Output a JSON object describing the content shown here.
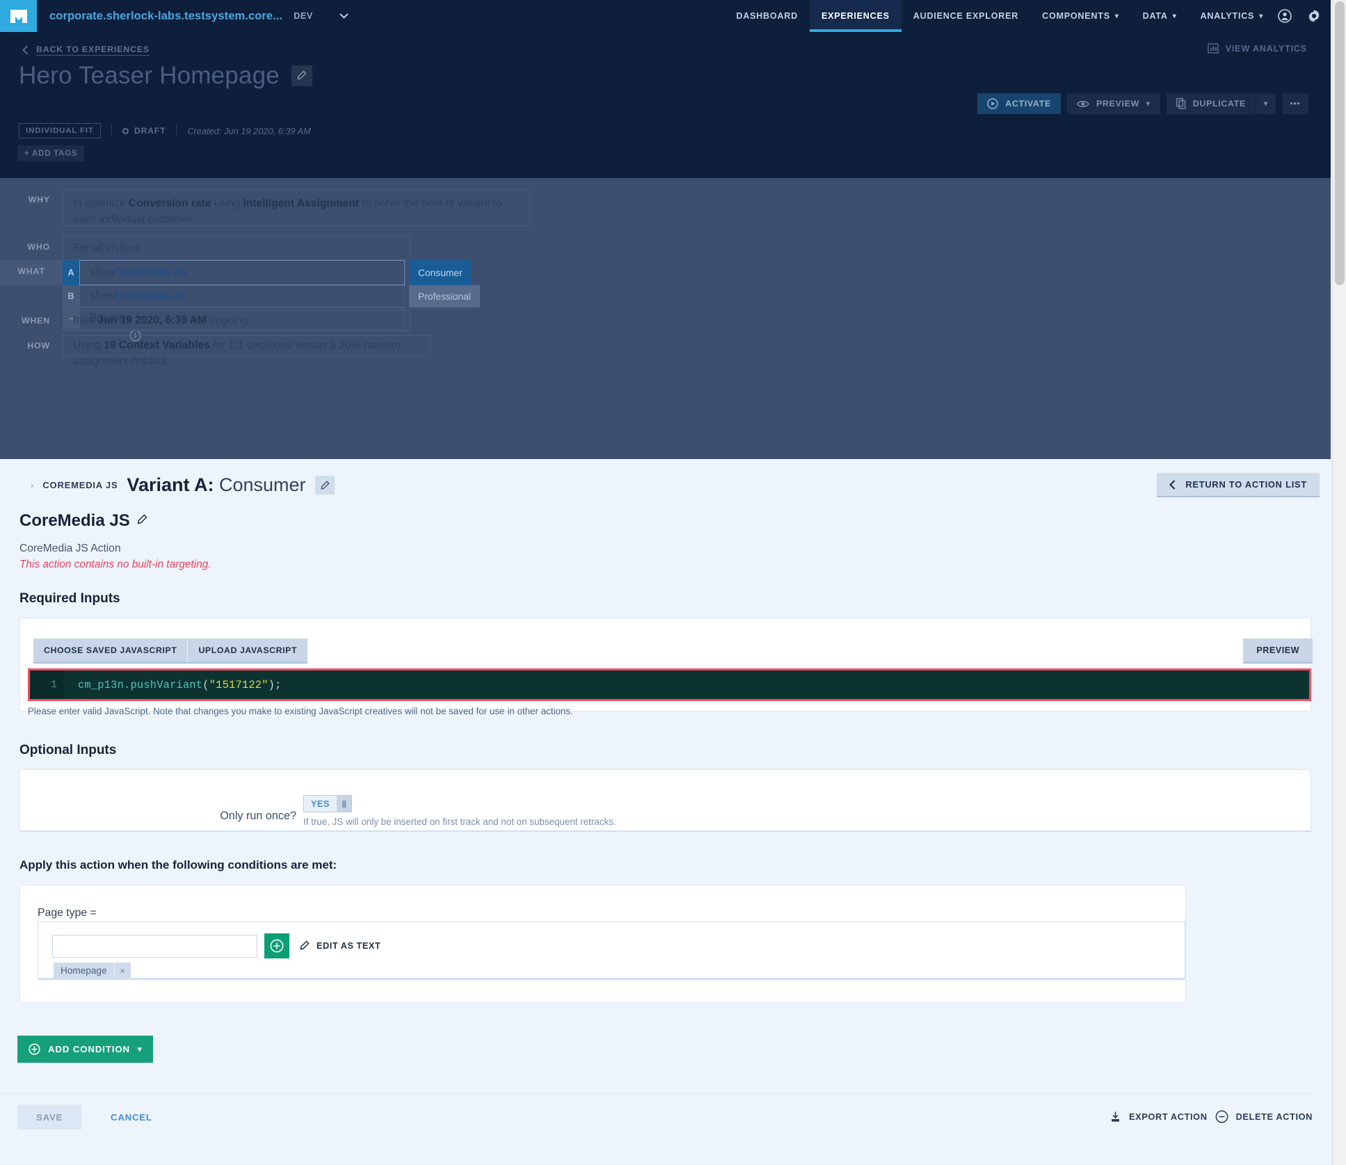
{
  "topnav": {
    "logo_icon": "mailbox-logo-icon",
    "site_name": "corporate.sherlock-labs.testsystem.core...",
    "env": "DEV",
    "env_caret_icon": "chevron-down-icon",
    "items": [
      {
        "label": "DASHBOARD",
        "caret": false,
        "active": false
      },
      {
        "label": "EXPERIENCES",
        "caret": false,
        "active": true
      },
      {
        "label": "AUDIENCE EXPLORER",
        "caret": false,
        "active": false
      },
      {
        "label": "COMPONENTS",
        "caret": true,
        "active": false
      },
      {
        "label": "DATA",
        "caret": true,
        "active": false
      },
      {
        "label": "ANALYTICS",
        "caret": true,
        "active": false
      }
    ],
    "account_icon": "user-circle-icon",
    "settings_icon": "gear-icon"
  },
  "header": {
    "back_label": "BACK TO EXPERIENCES",
    "back_icon": "chevron-left-icon",
    "view_analytics": "VIEW ANALYTICS",
    "view_analytics_icon": "bar-chart-icon",
    "title": "Hero Teaser Homepage",
    "title_edit_icon": "pencil-icon",
    "fit_badge": "INDIVIDUAL FIT",
    "status": "DRAFT",
    "created": "Created: Jun 19 2020, 6:39 AM",
    "add_tags": "+ ADD TAGS",
    "actions": {
      "activate": "ACTIVATE",
      "activate_icon": "play-circle-icon",
      "preview": "PREVIEW",
      "preview_icon": "eye-icon",
      "preview_caret": "chevron-down-icon",
      "duplicate": "DUPLICATE",
      "duplicate_icon": "copy-icon",
      "duplicate_caret": "chevron-down-icon",
      "more": "•••"
    }
  },
  "summary": {
    "why_label": "WHY",
    "why_pre": "to optimize ",
    "why_b1": "Conversion rate",
    "why_mid": " using ",
    "why_b2": "Intelligent Assignment",
    "why_post": " to serve the best-fit variant to each individual customer.",
    "who_label": "WHO",
    "who_value": "For all visitors",
    "what_label": "WHAT",
    "variants": [
      {
        "badge": "A",
        "pre": "show ",
        "name": "CoreMedia JS",
        "tag": "Consumer",
        "selected": true
      },
      {
        "badge": "B",
        "pre": "show ",
        "name": "CoreMedia JS",
        "tag": "Professional",
        "selected": false
      },
      {
        "badge": "–",
        "pre": "Baseline",
        "name": "",
        "tag": "",
        "selected": false
      }
    ],
    "add_variant_icon": "plus-circle-icon",
    "when_label": "WHEN",
    "when_pre": "from ",
    "when_b": "Jun 19 2020, 6:39 AM",
    "when_post": " ongoing",
    "how_label": "HOW",
    "how_pre": "Using ",
    "how_b": "19 Context Variables",
    "how_post": " for 1:1 decisions versus a 20% random assignment holdout"
  },
  "detail": {
    "crumb_chevron_icon": "chevron-right-icon",
    "crumb_parent": "COREMEDIA JS",
    "variant_bold": "Variant A:",
    "variant_light": " Consumer",
    "variant_edit_icon": "pencil-icon",
    "return_label": "RETURN TO ACTION LIST",
    "return_icon": "chevron-left-icon",
    "action_title": "CoreMedia JS",
    "action_edit_icon": "pencil-icon",
    "action_subtitle": "CoreMedia JS Action",
    "action_warning": "This action contains no built-in targeting.",
    "required_inputs_title": "Required Inputs",
    "tab_choose": "CHOOSE SAVED JAVASCRIPT",
    "tab_upload": "UPLOAD JAVASCRIPT",
    "preview_btn": "PREVIEW",
    "code_line_number": "1",
    "code_ident": "cm_p13n.pushVariant",
    "code_open": "(",
    "code_string": "\"1517122\"",
    "code_close": ");",
    "code_hint": "Please enter valid JavaScript. Note that changes you make to existing JavaScript creatives will not be saved for use in other actions.",
    "optional_inputs_title": "Optional Inputs",
    "only_run_once_label": "Only run once?",
    "toggle_value": "YES",
    "toggle_knob_icon": "grip-handle-icon",
    "toggle_hint": "If true, JS will only be inserted on first track and not on subsequent retracks.",
    "conditions_title": "Apply this action when the following conditions are met:",
    "condition_label": "Page type =",
    "condition_input_value": "",
    "condition_input_placeholder": "",
    "add_value_icon": "plus-circle-icon",
    "edit_as_text": "EDIT AS TEXT",
    "edit_as_text_icon": "pencil-icon",
    "condition_pill": "Homepage",
    "condition_pill_remove": "×",
    "add_condition": "ADD CONDITION",
    "add_condition_icon": "plus-circle-icon",
    "add_condition_caret": "chevron-down-icon",
    "save": "SAVE",
    "cancel": "CANCEL",
    "export_action": "EXPORT ACTION",
    "export_icon": "download-icon",
    "delete_action": "DELETE ACTION",
    "delete_icon": "minus-circle-icon"
  },
  "colors": {
    "brand_blue": "#2eaae0",
    "nav_bg": "#0e1f3c",
    "summary_dim": "#3d4f6e",
    "panel_bg": "#eef4fc",
    "green": "#16a07a",
    "error_red": "#f14e63",
    "warn_red": "#e0445e"
  }
}
